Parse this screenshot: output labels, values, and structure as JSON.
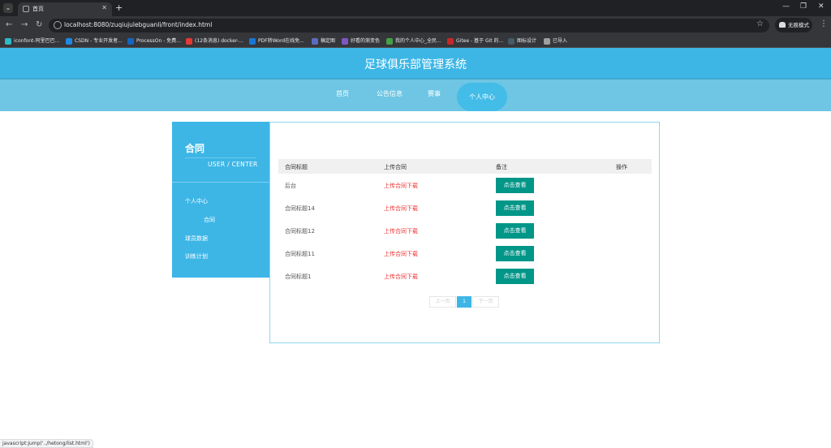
{
  "browser": {
    "tab_title": "首页",
    "new_tab": "+",
    "url": "localhost:8080/zuqiujulebguanli/front/index.html",
    "incognito_label": "无痕模式",
    "bookmarks": [
      {
        "label": "iconfont-阿里巴巴...",
        "color": "#2fb9c9"
      },
      {
        "label": "CSDN - 专业开发者...",
        "color": "#1e88e5"
      },
      {
        "label": "ProcessOn - 免费...",
        "color": "#1565c0"
      },
      {
        "label": "(12条消息) docker-...",
        "color": "#e53935"
      },
      {
        "label": "PDF转Word在线免...",
        "color": "#1976d2"
      },
      {
        "label": "稿定图",
        "color": "#5c6bc0"
      },
      {
        "label": "好看的渐变色",
        "color": "#7e57c2"
      },
      {
        "label": "我的个人中心_全民...",
        "color": "#43a047"
      },
      {
        "label": "Gitee - 基于 Git 的...",
        "color": "#c62828"
      },
      {
        "label": "图标设计",
        "color": "#455a64"
      },
      {
        "label": "已导入",
        "color": "#9e9e9e"
      }
    ]
  },
  "site": {
    "title": "足球俱乐部管理系统",
    "nav": [
      "首页",
      "公告信息",
      "赛事",
      "个人中心"
    ]
  },
  "sidebar": {
    "title": "合同",
    "subtitle": "USER / CENTER",
    "items": [
      "个人中心",
      "合同",
      "球员数据",
      "训练计划"
    ]
  },
  "table": {
    "headers": [
      "合同标题",
      "上传合同",
      "备注",
      "操作"
    ],
    "rows": [
      {
        "title": "后台",
        "upload": "上传合同下载",
        "action": "点击查看"
      },
      {
        "title": "合同标题14",
        "upload": "上传合同下载",
        "action": "点击查看"
      },
      {
        "title": "合同标题12",
        "upload": "上传合同下载",
        "action": "点击查看"
      },
      {
        "title": "合同标题11",
        "upload": "上传合同下载",
        "action": "点击查看"
      },
      {
        "title": "合同标题1",
        "upload": "上传合同下载",
        "action": "点击查看"
      }
    ]
  },
  "pagination": {
    "prev": "上一页",
    "current": "1",
    "next": "下一页"
  },
  "status_url": "javascript:jump('../hetong/list.html')",
  "colors": {
    "header": "#3db6e6",
    "nav": "#6ec6e4",
    "button": "#009688",
    "link": "#e33333"
  }
}
